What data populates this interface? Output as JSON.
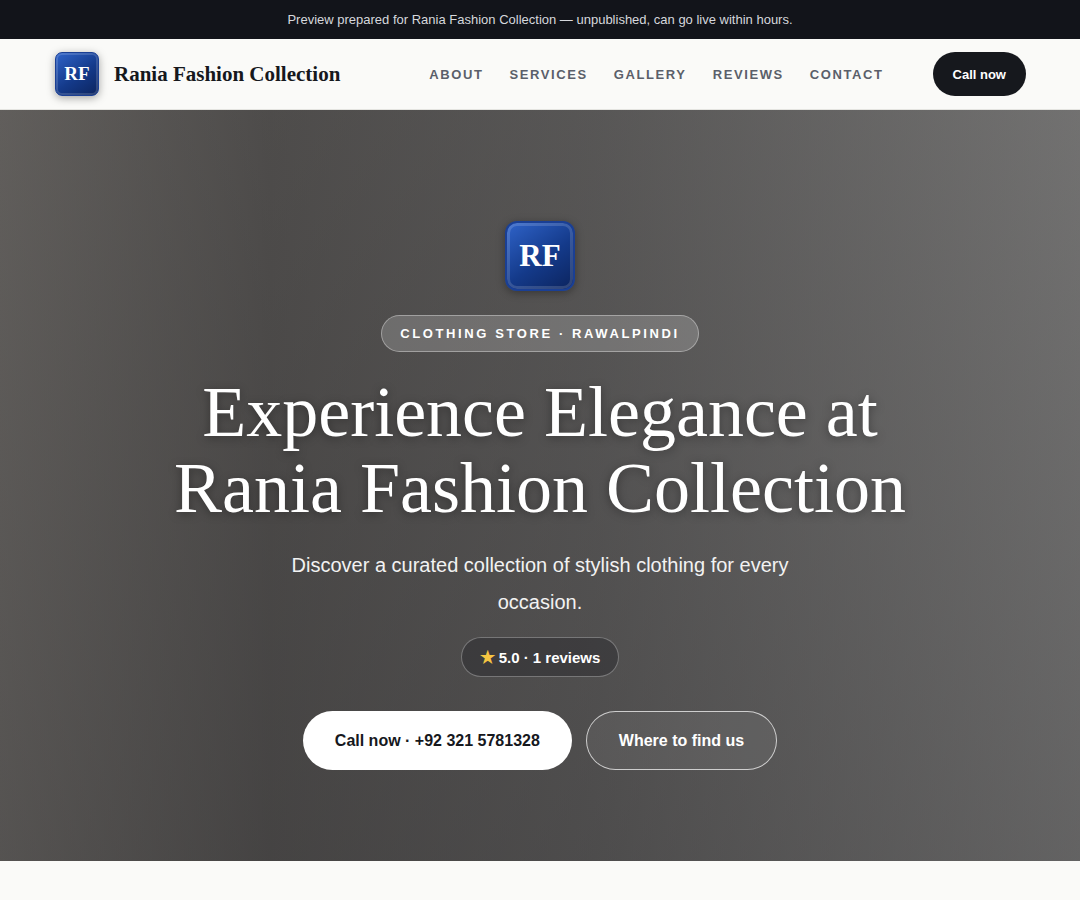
{
  "topbar": {
    "text": "Preview prepared for Rania Fashion Collection — unpublished, can go live within hours."
  },
  "brand": {
    "initials": "RF",
    "name": "Rania Fashion Collection"
  },
  "nav": {
    "links": [
      "ABOUT",
      "SERVICES",
      "GALLERY",
      "REVIEWS",
      "CONTACT"
    ],
    "cta": "Call now"
  },
  "hero": {
    "initials": "RF",
    "badge": "CLOTHING STORE · RAWALPINDI",
    "title": "Experience Elegance at Rania Fashion Collection",
    "subtitle": "Discover a curated collection of stylish clothing for every occasion.",
    "rating": {
      "star": "★",
      "text": "5.0 · 1 reviews"
    },
    "buttons": [
      {
        "label": "Call now · +92 321 5781328",
        "kind": "primary"
      },
      {
        "label": "Where to find us",
        "kind": "outline"
      }
    ]
  }
}
